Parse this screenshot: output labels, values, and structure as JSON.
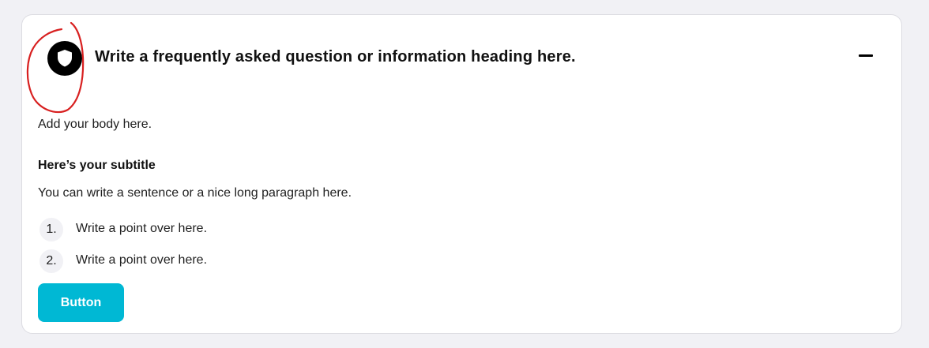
{
  "accordion": {
    "heading": "Write a frequently asked question or information heading here.",
    "expanded_indicator": "collapse",
    "icon": "shield-icon",
    "body": "Add your body here.",
    "subtitle": "Here’s your subtitle",
    "paragraph": "You can write a sentence or a nice long paragraph here.",
    "points": [
      {
        "number": "1.",
        "text": "Write a point over here."
      },
      {
        "number": "2.",
        "text": "Write a point over here."
      }
    ],
    "button_label": "Button"
  },
  "colors": {
    "page_background": "#f1f1f5",
    "card_background": "#ffffff",
    "button_accent": "#00b8d4",
    "annotation_ring": "#d82020"
  }
}
